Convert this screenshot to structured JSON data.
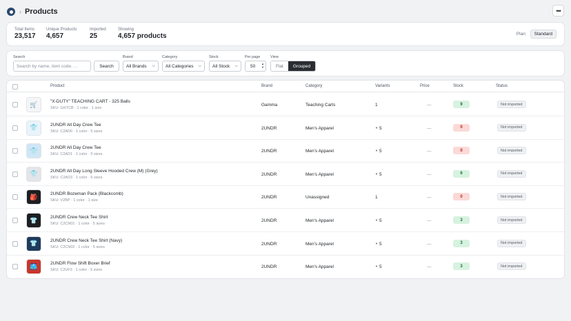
{
  "header": {
    "title": "Products",
    "logo_icon": "app-logo-icon",
    "more_icon": "more-icon"
  },
  "stats": [
    {
      "label": "Total Items",
      "value": "23,517"
    },
    {
      "label": "Unique Products",
      "value": "4,657"
    },
    {
      "label": "Imported",
      "value": "25"
    },
    {
      "label": "Showing",
      "value": "4,657 products"
    }
  ],
  "plan": {
    "label": "Plan:",
    "value": "Standard"
  },
  "filters": {
    "search_label": "Search",
    "search_placeholder": "Search by name, item code, ...",
    "search_button": "Search",
    "brand_label": "Brand",
    "brand_value": "All Brands",
    "category_label": "Category",
    "category_value": "All Categories",
    "stock_label": "Stock",
    "stock_value": "All Stock",
    "perpage_label": "Per page",
    "perpage_value": "50",
    "view_label": "View",
    "view_flat": "Flat",
    "view_grouped": "Grouped",
    "view_selected": "Grouped"
  },
  "table": {
    "columns": [
      "Product",
      "Brand",
      "Category",
      "Variants",
      "Price",
      "Stock",
      "Status"
    ],
    "rows": [
      {
        "name": "\"X-DUTY\" TEACHING CART - 325 Balls",
        "sub": "SKU: GHTCB · 1 color · 1 size",
        "brand": "Gamma",
        "category": "Teaching Carts",
        "variants": "1",
        "expandable": false,
        "price": "—",
        "stock": "9",
        "status": "Not imported",
        "thumb_icon": "cart-icon",
        "thumb_bg": "#f4f5f7"
      },
      {
        "name": "2UNDR All Day Crew Tee",
        "sub": "SKU: C2AD0 · 1 color · 5 sizes",
        "brand": "2UNDR",
        "category": "Men's Apparel",
        "variants": "5",
        "expandable": true,
        "price": "—",
        "stock": "0",
        "status": "Not imported",
        "thumb_icon": "tshirt-icon",
        "thumb_bg": "#e8f3fb"
      },
      {
        "name": "2UNDR All Day Crew Tee",
        "sub": "SKU: C2AD1 · 1 color · 5 sizes",
        "brand": "2UNDR",
        "category": "Men's Apparel",
        "variants": "5",
        "expandable": true,
        "price": "—",
        "stock": "0",
        "status": "Not imported",
        "thumb_icon": "tshirt-icon",
        "thumb_bg": "#cfe6f6"
      },
      {
        "name": "2UNDR All Day Long Sleeve Hooded Crew (M) (Grey)",
        "sub": "SKU: C2AD3 · 1 color · 5 sizes",
        "brand": "2UNDR",
        "category": "Men's Apparel",
        "variants": "5",
        "expandable": true,
        "price": "—",
        "stock": "6",
        "status": "Not imported",
        "thumb_icon": "tshirt-icon",
        "thumb_bg": "#e3e5e8"
      },
      {
        "name": "2UNDR Bozeman Pack (Blackcomb)",
        "sub": "SKU: V2BP · 1 color · 1 size",
        "brand": "2UNDR",
        "category": "Unassigned",
        "variants": "1",
        "expandable": false,
        "price": "—",
        "stock": "0",
        "status": "Not imported",
        "thumb_icon": "backpack-icon",
        "thumb_bg": "#1d1f22"
      },
      {
        "name": "2UNDR Crew Neck Tee Shirt",
        "sub": "SKU: C2CN01 · 1 color · 5 sizes",
        "brand": "2UNDR",
        "category": "Men's Apparel",
        "variants": "5",
        "expandable": true,
        "price": "—",
        "stock": "3",
        "status": "Not imported",
        "thumb_icon": "tshirt-icon",
        "thumb_bg": "#1d1f22"
      },
      {
        "name": "2UNDR Crew Neck Tee Shirt (Navy)",
        "sub": "SKU: C2CN02 · 1 color · 5 sizes",
        "brand": "2UNDR",
        "category": "Men's Apparel",
        "variants": "5",
        "expandable": true,
        "price": "—",
        "stock": "3",
        "status": "Not imported",
        "thumb_icon": "tshirt-icon",
        "thumb_bg": "#1f3b5c"
      },
      {
        "name": "2UNDR Flow Shift Boxer Brief",
        "sub": "SKU: C2UF3 · 1 color · 5 sizes",
        "brand": "2UNDR",
        "category": "Men's Apparel",
        "variants": "5",
        "expandable": true,
        "price": "—",
        "stock": "3",
        "status": "Not imported",
        "thumb_icon": "shorts-icon",
        "thumb_bg": "#c9362b"
      }
    ]
  }
}
